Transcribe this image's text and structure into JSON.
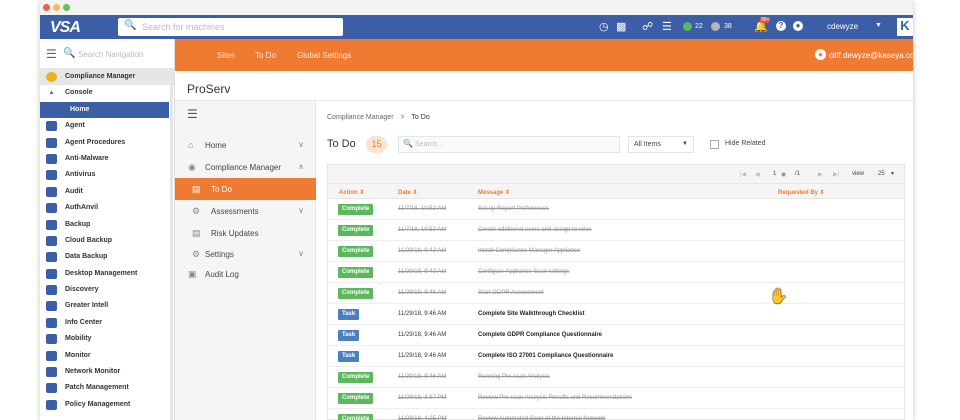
{
  "window": {
    "traffic_colors": [
      "#ee5c52",
      "#f5bd4f",
      "#5fc453"
    ]
  },
  "topbar": {
    "logo": "VSA",
    "search_placeholder": "Search for machines",
    "status_green_count": "22",
    "status_gray_count": "38",
    "notification_count": "99+",
    "username": "cdewyze",
    "brand_letter": "K"
  },
  "leftnav": {
    "search_placeholder": "Search Navigation",
    "items": [
      {
        "label": "Compliance Manager",
        "icon": "compliance-icon"
      },
      {
        "label": "Console",
        "icon": "caret-up-icon"
      },
      {
        "label": "Home",
        "icon": ""
      },
      {
        "label": "Agent",
        "icon": "agent-icon"
      },
      {
        "label": "Agent Procedures",
        "icon": "agent-procedures-icon"
      },
      {
        "label": "Anti-Malware",
        "icon": "anti-malware-icon"
      },
      {
        "label": "Antivirus",
        "icon": "antivirus-icon"
      },
      {
        "label": "Audit",
        "icon": "audit-icon"
      },
      {
        "label": "AuthAnvil",
        "icon": "authanvil-icon"
      },
      {
        "label": "Backup",
        "icon": "backup-icon"
      },
      {
        "label": "Cloud Backup",
        "icon": "cloud-backup-icon"
      },
      {
        "label": "Data Backup",
        "icon": "data-backup-icon"
      },
      {
        "label": "Desktop Management",
        "icon": "desktop-management-icon"
      },
      {
        "label": "Discovery",
        "icon": "discovery-icon"
      },
      {
        "label": "Greater Intell",
        "icon": "greater-intell-icon"
      },
      {
        "label": "Info Center",
        "icon": "info-center-icon"
      },
      {
        "label": "Mobility",
        "icon": "mobility-icon"
      },
      {
        "label": "Monitor",
        "icon": "monitor-icon"
      },
      {
        "label": "Network Monitor",
        "icon": "network-monitor-icon"
      },
      {
        "label": "Patch Management",
        "icon": "patch-management-icon"
      },
      {
        "label": "Policy Management",
        "icon": "policy-management-icon"
      }
    ]
  },
  "orangebar": {
    "tabs": [
      "Sites",
      "To Do",
      "Global Settings"
    ],
    "email": "cliff.dewyze@kaseya.com"
  },
  "org": {
    "title": "ProServ"
  },
  "subnav": {
    "items": [
      {
        "label": "Home"
      },
      {
        "label": "Compliance Manager"
      },
      {
        "label": "To Do"
      },
      {
        "label": "Assessments"
      },
      {
        "label": "Risk Updates"
      },
      {
        "label": "Settings"
      },
      {
        "label": "Audit Log"
      }
    ]
  },
  "breadcrumb": {
    "parent": "Compliance Manager",
    "separator": ">",
    "current": "To Do"
  },
  "page": {
    "title": "To Do",
    "count": "15",
    "search_placeholder": "Search...",
    "filter_value": "All Items",
    "hide_related_label": "Hide Related"
  },
  "pager": {
    "page": "1",
    "total": "/1",
    "view_label": "view",
    "page_size": "25"
  },
  "table": {
    "columns": [
      "Action",
      "Date",
      "Message",
      "Requested By"
    ],
    "rows": [
      {
        "action": "Complete",
        "date": "11/7/18, 10:52 AM",
        "message": "Set up Report Preferences"
      },
      {
        "action": "Complete",
        "date": "11/7/18, 10:52 AM",
        "message": "Create additional users and assign to roles"
      },
      {
        "action": "Complete",
        "date": "11/29/18, 9:42 AM",
        "message": "Install Compliance Manager Appliance"
      },
      {
        "action": "Complete",
        "date": "11/29/18, 9:43 AM",
        "message": "Configure Appliance Scan settings"
      },
      {
        "action": "Complete",
        "date": "11/29/18, 9:46 AM",
        "message": "Start GDPR Assessment"
      },
      {
        "action": "Task",
        "date": "11/29/18, 9:46 AM",
        "message": "Complete Site Walkthrough Checklist"
      },
      {
        "action": "Task",
        "date": "11/29/18, 9:46 AM",
        "message": "Complete GDPR Compliance Questionnaire"
      },
      {
        "action": "Task",
        "date": "11/29/18, 9:46 AM",
        "message": "Complete ISO 27001 Compliance Questionnaire"
      },
      {
        "action": "Complete",
        "date": "11/29/18, 9:46 AM",
        "message": "Running Pre-scan Analysis"
      },
      {
        "action": "Complete",
        "date": "11/29/18, 3:57 PM",
        "message": "Review Pre-scan Analysis Results and Recommendations"
      },
      {
        "action": "Complete",
        "date": "11/29/18, 4:25 PM",
        "message": "Review Automated Scan of the Internal Network"
      }
    ]
  },
  "colors": {
    "topbar": "#3b5ea7",
    "accent_orange": "#ef7b33",
    "complete_green": "#5cb85c",
    "task_blue": "#4a7fc1"
  }
}
